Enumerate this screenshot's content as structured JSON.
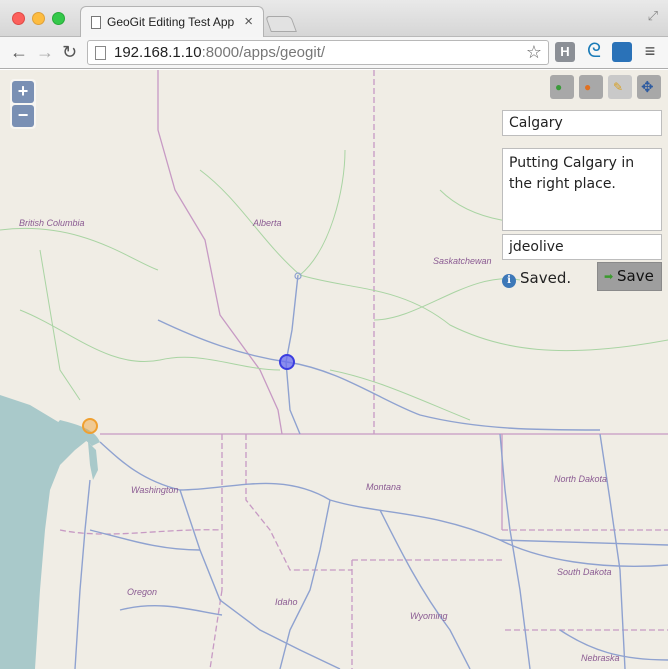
{
  "browser": {
    "tab_title": "GeoGit Editing Test App",
    "url_host": "192.168.1.10",
    "url_rest": ":8000/apps/geogit/",
    "extension_h_label": "H"
  },
  "map": {
    "zoom_in_label": "+",
    "zoom_out_label": "−",
    "places": [
      "British Columbia",
      "Alberta",
      "Saskatchewan",
      "Washington",
      "Montana",
      "North Dakota",
      "South Dakota",
      "Oregon",
      "Idaho",
      "Wyoming",
      "Nebraska"
    ],
    "colors": {
      "land": "#f0ede5",
      "water": "#a9c9ca",
      "roads": "#8fa2d0",
      "minor_roads": "#a9d4a3",
      "borders": "#c79ac4",
      "point_blue": "#4a4ce0",
      "point_orange": "#f0a030"
    }
  },
  "editor": {
    "name_value": "Calgary",
    "message_value": "Putting Calgary in the right place.",
    "author_value": "jdeolive",
    "status_text": "Saved.",
    "save_label": "Save",
    "tools": [
      "add-point-icon",
      "delete-point-icon",
      "pencil-icon",
      "move-icon"
    ]
  }
}
